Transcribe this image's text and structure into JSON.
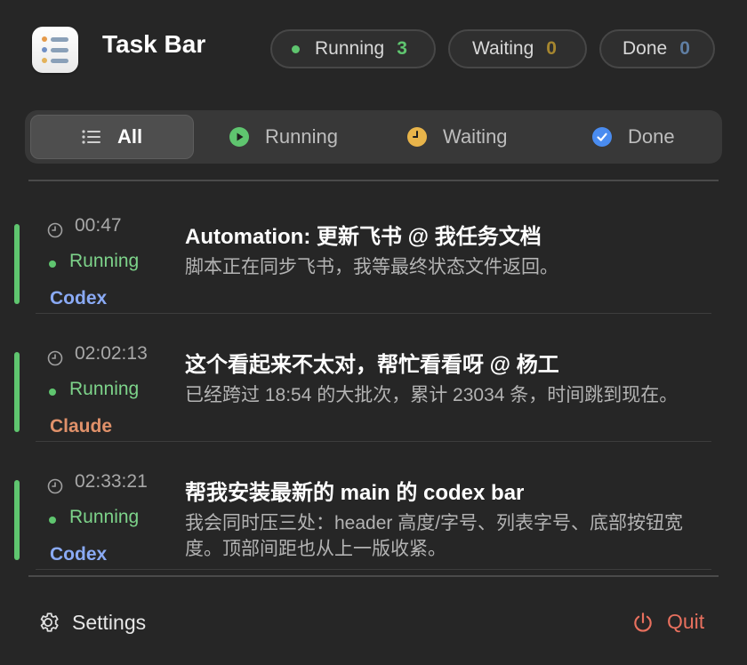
{
  "app": {
    "title": "Task Bar"
  },
  "summary": [
    {
      "label": "Running",
      "count": "3",
      "count_color": "#5fc56f",
      "dot_color": "#5fc56f"
    },
    {
      "label": "Waiting",
      "count": "0",
      "count_color": "#a6862f"
    },
    {
      "label": "Done",
      "count": "0",
      "count_color": "#5f7ea3"
    }
  ],
  "tabs": [
    {
      "label": "All",
      "icon": "list-icon",
      "active": true
    },
    {
      "label": "Running",
      "icon": "play-circle-icon",
      "color": "#5fc56f"
    },
    {
      "label": "Waiting",
      "icon": "clock-circle-icon",
      "color": "#e8b44a"
    },
    {
      "label": "Done",
      "icon": "check-circle-icon",
      "color": "#4a8cf0"
    }
  ],
  "tasks": [
    {
      "time": "00:47",
      "status": "Running",
      "agent": "Codex",
      "agent_color": "#8aaaf5",
      "title": "Automation: 更新飞书 @ 我任务文档",
      "description": "脚本正在同步飞书，我等最终状态文件返回。"
    },
    {
      "time": "02:02:13",
      "status": "Running",
      "agent": "Claude",
      "agent_color": "#e0916a",
      "title": "这个看起来不太对，帮忙看看呀 @ 杨工",
      "description": "已经跨过 18:54 的大批次，累计 23034 条，时间跳到现在。"
    },
    {
      "time": "02:33:21",
      "status": "Running",
      "agent": "Codex",
      "agent_color": "#8aaaf5",
      "title": "帮我安装最新的 main 的 codex bar",
      "description": "我会同时压三处：header 高度/字号、列表字号、底部按钮宽度。顶部间距也从上一版收紧。"
    }
  ],
  "footer": {
    "settings_label": "Settings",
    "quit_label": "Quit",
    "quit_color": "#e8705e"
  }
}
